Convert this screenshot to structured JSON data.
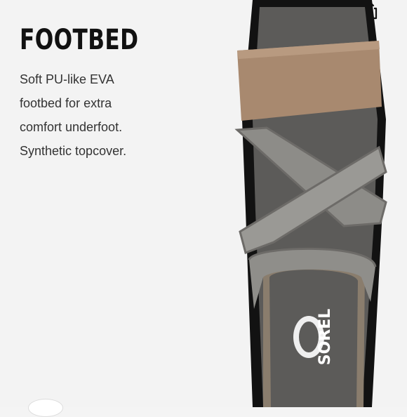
{
  "feature": {
    "title": "FOOTBED",
    "description_lines": [
      "Soft PU-like EVA",
      "footbed for extra",
      "comfort underfoot.",
      "Synthetic topcover."
    ]
  },
  "toolbar": {
    "share_icon": "share-icon"
  },
  "product": {
    "brand_logo_text": "SOREL",
    "colors": {
      "strap": "#a88a70",
      "footbed": "#5b5a58",
      "sole": "#111111"
    }
  }
}
